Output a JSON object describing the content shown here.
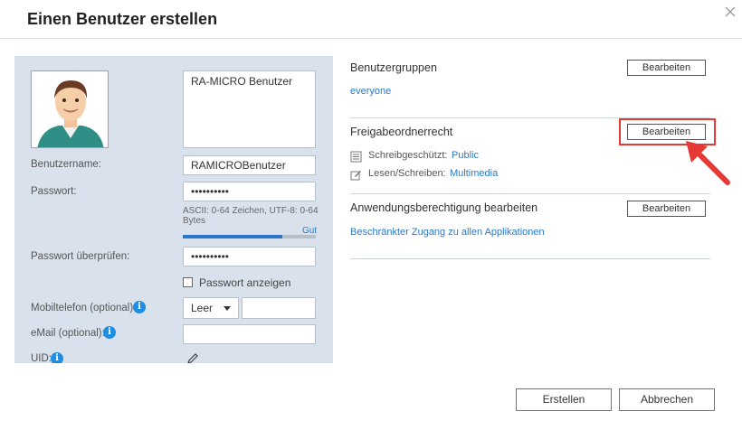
{
  "dialog": {
    "title": "Einen Benutzer erstellen",
    "close_icon": "close-icon"
  },
  "left": {
    "description": "RA-MICRO Benutzer",
    "username_label": "Benutzername:",
    "username_value": "RAMICROBenutzer",
    "password_label": "Passwort:",
    "password_value": "••••••••••",
    "password_hint": "ASCII: 0-64 Zeichen, UTF-8: 0-64 Bytes",
    "strength_text": "Gut",
    "strength_fraction": 0.75,
    "confirm_label": "Passwort überprüfen:",
    "confirm_value": "••••••••••",
    "show_password_label": "Passwort anzeigen",
    "mobile_label": "Mobiltelefon (optional):",
    "mobile_select": "Leer",
    "mobile_value": "",
    "email_label": "eMail (optional):",
    "email_value": "",
    "uid_label": "UID:"
  },
  "right": {
    "groups_title": "Benutzergruppen",
    "groups_button": "Bearbeiten",
    "groups_value": "everyone",
    "share_title": "Freigabeordnerrecht",
    "share_button": "Bearbeiten",
    "readonly_label": "Schreibgeschützt:",
    "readonly_value": "Public",
    "readwrite_label": "Lesen/Schreiben:",
    "readwrite_value": "Multimedia",
    "app_title": "Anwendungsberechtigung bearbeiten",
    "app_button": "Bearbeiten",
    "app_value": "Beschränkter Zugang zu allen Applikationen"
  },
  "footer": {
    "create": "Erstellen",
    "cancel": "Abbrechen"
  },
  "colors": {
    "panel": "#d9e2ec",
    "link": "#2a79c8",
    "info": "#1c8fe3",
    "highlight": "#e53935"
  }
}
